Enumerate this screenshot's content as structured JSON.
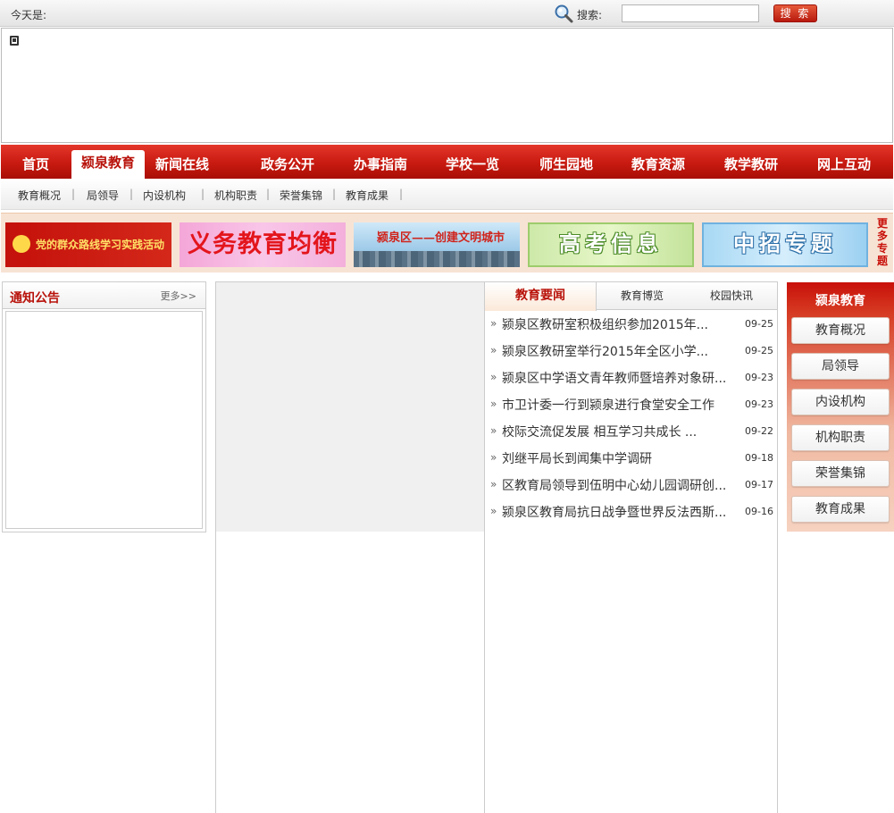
{
  "topbar": {
    "date_label": "今天是:",
    "search_label": "搜索:",
    "search_value": "",
    "search_button": "搜 索"
  },
  "main_nav": {
    "items": [
      "首页",
      "颍泉教育",
      "新闻在线",
      "政务公开",
      "办事指南",
      "学校一览",
      "师生园地",
      "教育资源",
      "教学教研",
      "网上互动"
    ],
    "active_index": 1
  },
  "sub_nav": {
    "items": [
      "教育概况",
      "局领导",
      "内设机构",
      "机构职责",
      "荣誉集锦",
      "教育成果"
    ],
    "separator": "|"
  },
  "promo": {
    "banners": [
      "党的群众路线学习实践活动专题",
      "义务教育均衡发展",
      "颍泉区——创建文明城市",
      "高考信息",
      "中招专题"
    ],
    "more_label": "更多专题"
  },
  "notice": {
    "title": "通知公告",
    "more_label": "更多>>"
  },
  "news": {
    "tabs": [
      "教育要闻",
      "教育博览",
      "校园快讯"
    ],
    "active_tab": 0,
    "items": [
      {
        "title": "颍泉区教研室积极组织参加2015年...",
        "date": "09-25"
      },
      {
        "title": "颍泉区教研室举行2015年全区小学...",
        "date": "09-25"
      },
      {
        "title": "颍泉区中学语文青年教师暨培养对象研...",
        "date": "09-23"
      },
      {
        "title": "市卫计委一行到颍泉进行食堂安全工作",
        "date": "09-23"
      },
      {
        "title": "校际交流促发展  相互学习共成长  ...",
        "date": "09-22"
      },
      {
        "title": "刘继平局长到闻集中学调研",
        "date": "09-18"
      },
      {
        "title": "区教育局领导到伍明中心幼儿园调研创...",
        "date": "09-17"
      },
      {
        "title": "颍泉区教育局抗日战争暨世界反法西斯...",
        "date": "09-16"
      }
    ],
    "arrow": "»"
  },
  "sidebar": {
    "title": "颍泉教育",
    "items": [
      "教育概况",
      "局领导",
      "内设机构",
      "机构职责",
      "荣誉集锦",
      "教育成果"
    ]
  }
}
